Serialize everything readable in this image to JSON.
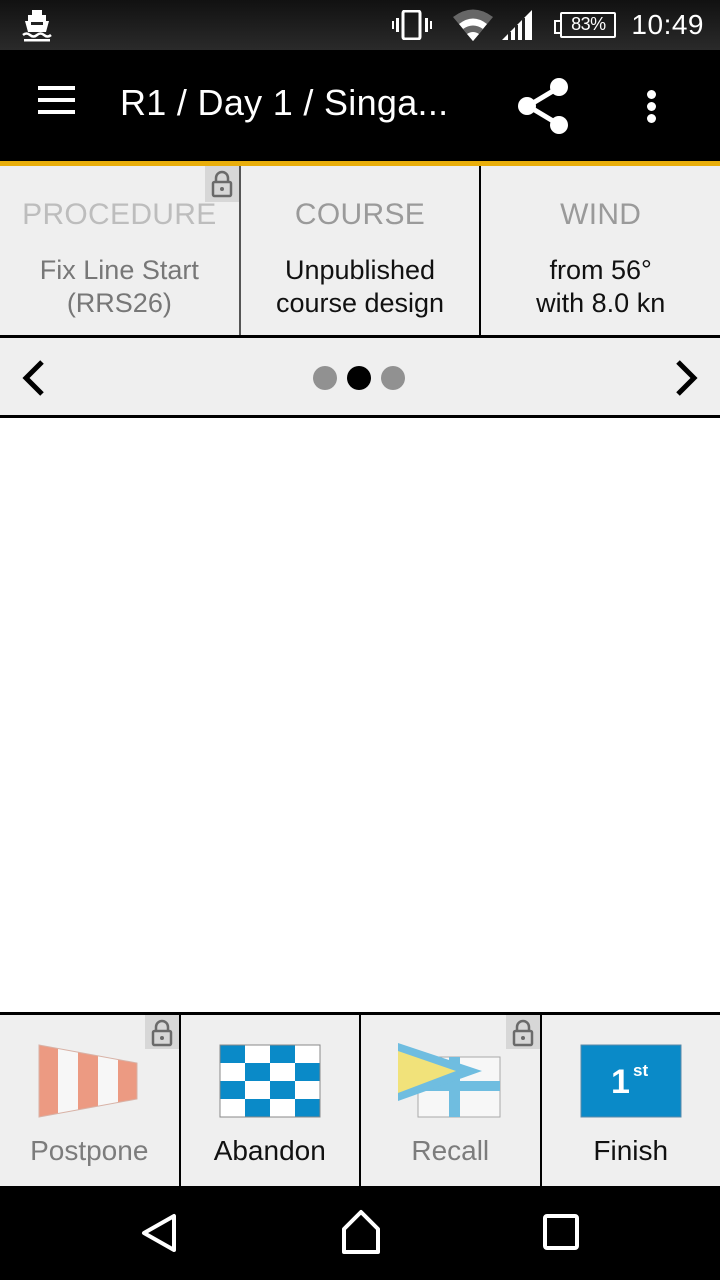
{
  "status_bar": {
    "notification_icon": "boat-icon",
    "icons": [
      "vibrate-icon",
      "wifi-icon",
      "cell-signal-icon"
    ],
    "battery": "83%",
    "time": "10:49"
  },
  "app_bar": {
    "title": "R1 / Day 1 / Singa...",
    "menu_icon": "hamburger-menu-icon",
    "share_icon": "share-icon",
    "more_icon": "more-vert-icon"
  },
  "colors": {
    "accent": "#e9ae0b",
    "flag_blue": "#0a8ac8",
    "postpone_red": "#ec9a82",
    "recall_yellow": "#f1e27a",
    "recall_blue": "#6fbde0"
  },
  "info_panels": [
    {
      "title": "PROCEDURE",
      "value_lines": [
        "Fix Line Start",
        "(RRS26)"
      ],
      "locked": true
    },
    {
      "title": "COURSE",
      "value_lines": [
        "Unpublished",
        "course design"
      ],
      "locked": false
    },
    {
      "title": "WIND",
      "value_lines": [
        "from 56°",
        "with 8.0 kn"
      ],
      "locked": false
    }
  ],
  "pager": {
    "prev_icon": "chevron-left-icon",
    "next_icon": "chevron-right-icon",
    "page_count": 3,
    "current_page": 2
  },
  "actions": [
    {
      "label": "Postpone",
      "flag": "postpone-flag-icon",
      "locked": true
    },
    {
      "label": "Abandon",
      "flag": "abandon-flag-icon",
      "locked": false
    },
    {
      "label": "Recall",
      "flag": "recall-flag-icon",
      "locked": true
    },
    {
      "label": "Finish",
      "flag": "finish-flag-icon",
      "flag_text": "1",
      "flag_sup": "st",
      "locked": false
    }
  ],
  "nav_bar": {
    "back": "back-icon",
    "home": "home-icon",
    "recents": "recents-icon"
  }
}
